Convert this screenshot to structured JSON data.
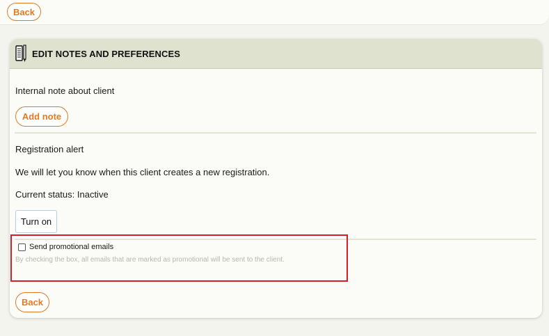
{
  "top": {
    "back_label": "Back"
  },
  "card": {
    "title": "EDIT NOTES AND PREFERENCES",
    "icon": "notebook-pencil-icon",
    "note_label": "Internal note about client",
    "add_note_label": "Add note",
    "alert_label": "Registration alert",
    "alert_description": "We will let you know when this client creates a new registration.",
    "status_text": "Current status: Inactive",
    "turn_on_label": "Turn on",
    "promo_checkbox_label": "Send promotional emails",
    "promo_checked": false,
    "promo_description": "By checking the box, all emails that are marked as promotional will be sent to the client.",
    "back_label": "Back"
  },
  "colors": {
    "accent": "#e07a25",
    "header_bg": "#dfe2cf",
    "highlight": "#d0202a"
  }
}
